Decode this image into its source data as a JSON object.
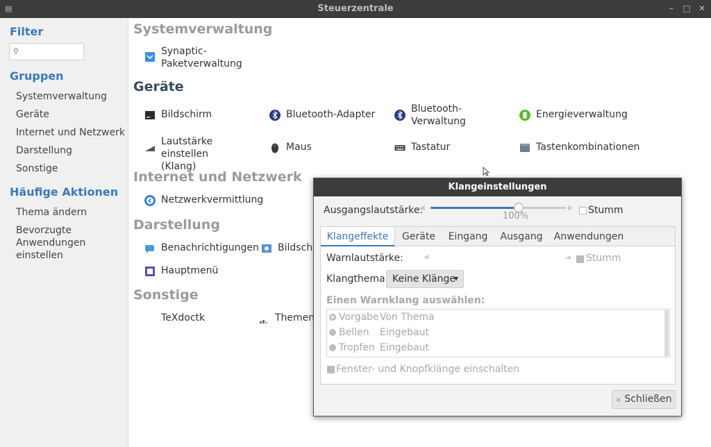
{
  "window": {
    "title": "Steuerzentrale"
  },
  "sidebar": {
    "filter_heading": "Filter",
    "search_placeholder": "",
    "groups_heading": "Gruppen",
    "groups": [
      "Systemverwaltung",
      "Geräte",
      "Internet und Netzwerk",
      "Darstellung",
      "Sonstige"
    ],
    "actions_heading": "Häufige Aktionen",
    "actions": [
      "Thema ändern",
      "Bevorzugte\nAnwendungen\neinstellen"
    ]
  },
  "content": {
    "system_heading": "Systemverwaltung",
    "synaptic": "Synaptic-\nPaketverwaltung",
    "devices_heading": "Geräte",
    "bildschirm": "Bildschirm",
    "bt_adapter": "Bluetooth-Adapter",
    "bt_manager": "Bluetooth-\nVerwaltung",
    "energy": "Energieverwaltung",
    "volume": "Lautstärke einstellen\n(Klang)",
    "mouse": "Maus",
    "keyboard": "Tastatur",
    "shortcuts": "Tastenkombinationen",
    "network_heading": "Internet und Netzwerk",
    "network_manager": "Netzwerkvermittlung",
    "appearance_heading": "Darstellung",
    "notifications": "Benachrichtigungen",
    "screensaver_partial": "Bildschi",
    "main_menu": "Hauptmenü",
    "other_heading": "Sonstige",
    "texdoctk": "TeXdoctk",
    "theme_partial": "Themeni"
  },
  "dialog": {
    "title": "Klangeinstellungen",
    "output_volume_label": "Ausgangslautstärke:",
    "output_volume_fraction": 0.65,
    "output_volume_text": "100%",
    "mute_label": "Stumm",
    "tabs": [
      "Klangeffekte",
      "Geräte",
      "Eingang",
      "Ausgang",
      "Anwendungen"
    ],
    "alert_volume_label": "Warnlautstärke:",
    "alert_mute_label": "Stumm",
    "theme_label": "Klangthema:",
    "theme_value": "Keine Klänge",
    "choose_alert_label": "Einen Warnklang auswählen:",
    "alerts": [
      {
        "name": "Vorgabe",
        "type": "Von Thema"
      },
      {
        "name": "Bellen",
        "type": "Eingebaut"
      },
      {
        "name": "Tropfen",
        "type": "Eingebaut"
      }
    ],
    "window_sounds_label": "Fenster- und Knopfklänge einschalten",
    "close_button": "Schließen"
  },
  "colors": {
    "accent": "#3b7ab8",
    "titlebar": "#3c3c3c",
    "sidebar_bg": "#f0f0f0"
  }
}
